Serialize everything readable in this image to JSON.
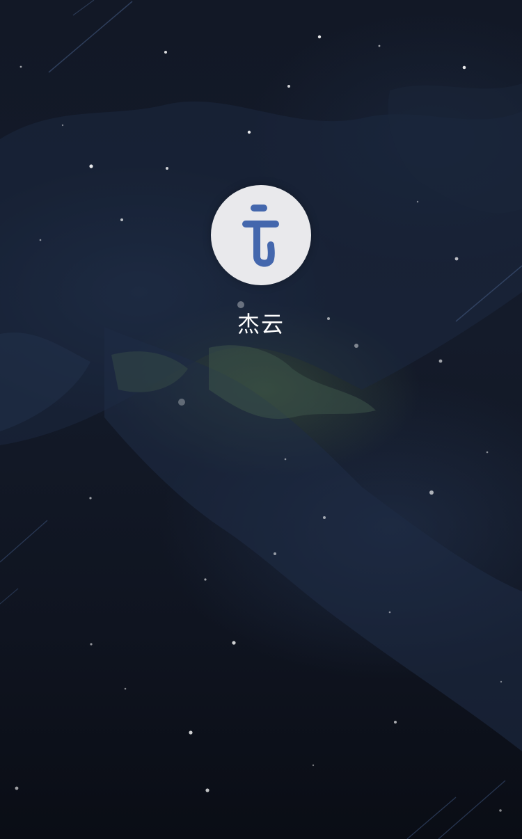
{
  "splash": {
    "app_name": "杰云",
    "logo_icon": "jieyun-logo-icon",
    "logo_background": "#e9e9ec",
    "logo_color": "#4467ad",
    "background": "starry-night-nebula"
  }
}
